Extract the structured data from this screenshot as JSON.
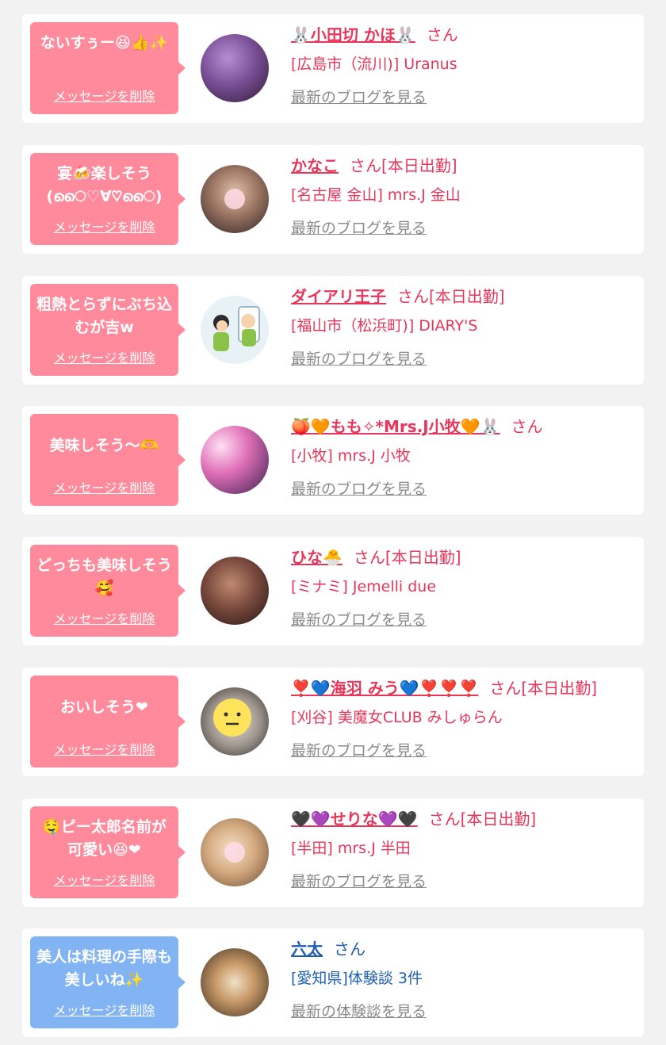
{
  "items": [
    {
      "message": "ないすぅー😆👍✨",
      "delete_label": "メッセージを削除",
      "name": "🐰小田切 かほ🐰",
      "honorific": "さん",
      "shop": "[広島市（流川)] Uranus",
      "blog_link": "最新のブログを見る",
      "bubble_color": "#ff8a9c",
      "avatar_colors": [
        "#9a6fb6",
        "#3a2540"
      ]
    },
    {
      "message": "宴🍻楽しそう(ൈ♡∀♡ൈ)",
      "delete_label": "メッセージを削除",
      "name": "かなこ",
      "honorific": "さん[本日出勤]",
      "shop": "[名古屋 金山] mrs.J 金山",
      "blog_link": "最新のブログを見る",
      "bubble_color": "#ff8a9c",
      "avatar_colors": [
        "#c4a28c",
        "#3b2e2e"
      ]
    },
    {
      "message": "粗熱とらずにぶち込むが吉w",
      "delete_label": "メッセージを削除",
      "name": "ダイアリ王子",
      "honorific": "さん[本日出勤]",
      "shop": "[福山市（松浜町)] DIARY'S",
      "blog_link": "最新のブログを見る",
      "bubble_color": "#ff8a9c",
      "avatar_colors": [
        "#e8f2f6",
        "#8bc34a"
      ]
    },
    {
      "message": "美味しそう～🫶",
      "delete_label": "メッセージを削除",
      "name": "🍑🧡もも✧*Mrs.J小牧🧡🐰",
      "honorific": "さん",
      "shop": "[小牧] mrs.J 小牧",
      "blog_link": "最新のブログを見る",
      "bubble_color": "#ff8a9c",
      "avatar_colors": [
        "#e880c0",
        "#4a2a5a"
      ]
    },
    {
      "message": "どっちも美味しそう🥰",
      "delete_label": "メッセージを削除",
      "name": "ひな🐣",
      "honorific": "さん[本日出勤]",
      "shop": "[ミナミ] Jemelli due",
      "blog_link": "最新のブログを見る",
      "bubble_color": "#ff8a9c",
      "avatar_colors": [
        "#8a5a4a",
        "#2a1a1a"
      ]
    },
    {
      "message": "おいしそう❤",
      "delete_label": "メッセージを削除",
      "name": "❣️💙海羽 みう💙❣️❣️❣️",
      "honorific": "さん[本日出勤]",
      "shop": "[刈谷] 美魔女CLUB みしゅらん",
      "blog_link": "最新のブログを見る",
      "bubble_color": "#ff8a9c",
      "avatar_colors": [
        "#d8d0c8",
        "#3a3030"
      ]
    },
    {
      "message": "🤤ピー太郎名前が可愛い😆❤",
      "delete_label": "メッセージを削除",
      "name": "🖤💜せりな💜🖤",
      "honorific": "さん[本日出勤]",
      "shop": "[半田] mrs.J 半田",
      "blog_link": "最新のブログを見る",
      "bubble_color": "#ff8a9c",
      "avatar_colors": [
        "#e8c8a0",
        "#8a6a50"
      ]
    },
    {
      "message": "美人は料理の手際も美しいね✨",
      "delete_label": "メッセージを削除",
      "name": "六太",
      "honorific": "さん",
      "shop": "[愛知県]体験談 3件",
      "blog_link": "最新の体験談を見る",
      "bubble_color": "#82b3f2",
      "avatar_colors": [
        "#c8a070",
        "#3a2a20"
      ]
    }
  ]
}
